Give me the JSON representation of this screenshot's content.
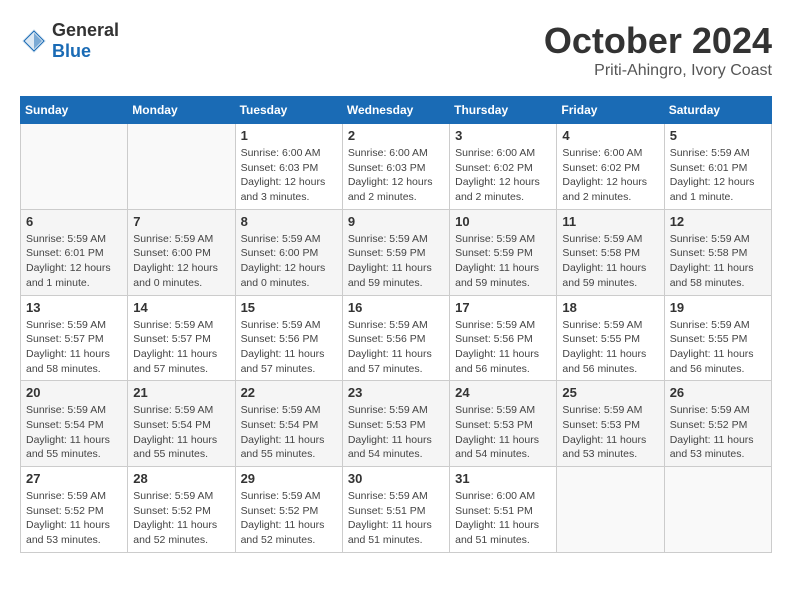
{
  "header": {
    "logo_general": "General",
    "logo_blue": "Blue",
    "month_title": "October 2024",
    "location": "Priti-Ahingro, Ivory Coast"
  },
  "weekdays": [
    "Sunday",
    "Monday",
    "Tuesday",
    "Wednesday",
    "Thursday",
    "Friday",
    "Saturday"
  ],
  "weeks": [
    [
      {
        "day": "",
        "info": ""
      },
      {
        "day": "",
        "info": ""
      },
      {
        "day": "1",
        "info": "Sunrise: 6:00 AM\nSunset: 6:03 PM\nDaylight: 12 hours and 3 minutes."
      },
      {
        "day": "2",
        "info": "Sunrise: 6:00 AM\nSunset: 6:03 PM\nDaylight: 12 hours and 2 minutes."
      },
      {
        "day": "3",
        "info": "Sunrise: 6:00 AM\nSunset: 6:02 PM\nDaylight: 12 hours and 2 minutes."
      },
      {
        "day": "4",
        "info": "Sunrise: 6:00 AM\nSunset: 6:02 PM\nDaylight: 12 hours and 2 minutes."
      },
      {
        "day": "5",
        "info": "Sunrise: 5:59 AM\nSunset: 6:01 PM\nDaylight: 12 hours and 1 minute."
      }
    ],
    [
      {
        "day": "6",
        "info": "Sunrise: 5:59 AM\nSunset: 6:01 PM\nDaylight: 12 hours and 1 minute."
      },
      {
        "day": "7",
        "info": "Sunrise: 5:59 AM\nSunset: 6:00 PM\nDaylight: 12 hours and 0 minutes."
      },
      {
        "day": "8",
        "info": "Sunrise: 5:59 AM\nSunset: 6:00 PM\nDaylight: 12 hours and 0 minutes."
      },
      {
        "day": "9",
        "info": "Sunrise: 5:59 AM\nSunset: 5:59 PM\nDaylight: 11 hours and 59 minutes."
      },
      {
        "day": "10",
        "info": "Sunrise: 5:59 AM\nSunset: 5:59 PM\nDaylight: 11 hours and 59 minutes."
      },
      {
        "day": "11",
        "info": "Sunrise: 5:59 AM\nSunset: 5:58 PM\nDaylight: 11 hours and 59 minutes."
      },
      {
        "day": "12",
        "info": "Sunrise: 5:59 AM\nSunset: 5:58 PM\nDaylight: 11 hours and 58 minutes."
      }
    ],
    [
      {
        "day": "13",
        "info": "Sunrise: 5:59 AM\nSunset: 5:57 PM\nDaylight: 11 hours and 58 minutes."
      },
      {
        "day": "14",
        "info": "Sunrise: 5:59 AM\nSunset: 5:57 PM\nDaylight: 11 hours and 57 minutes."
      },
      {
        "day": "15",
        "info": "Sunrise: 5:59 AM\nSunset: 5:56 PM\nDaylight: 11 hours and 57 minutes."
      },
      {
        "day": "16",
        "info": "Sunrise: 5:59 AM\nSunset: 5:56 PM\nDaylight: 11 hours and 57 minutes."
      },
      {
        "day": "17",
        "info": "Sunrise: 5:59 AM\nSunset: 5:56 PM\nDaylight: 11 hours and 56 minutes."
      },
      {
        "day": "18",
        "info": "Sunrise: 5:59 AM\nSunset: 5:55 PM\nDaylight: 11 hours and 56 minutes."
      },
      {
        "day": "19",
        "info": "Sunrise: 5:59 AM\nSunset: 5:55 PM\nDaylight: 11 hours and 56 minutes."
      }
    ],
    [
      {
        "day": "20",
        "info": "Sunrise: 5:59 AM\nSunset: 5:54 PM\nDaylight: 11 hours and 55 minutes."
      },
      {
        "day": "21",
        "info": "Sunrise: 5:59 AM\nSunset: 5:54 PM\nDaylight: 11 hours and 55 minutes."
      },
      {
        "day": "22",
        "info": "Sunrise: 5:59 AM\nSunset: 5:54 PM\nDaylight: 11 hours and 55 minutes."
      },
      {
        "day": "23",
        "info": "Sunrise: 5:59 AM\nSunset: 5:53 PM\nDaylight: 11 hours and 54 minutes."
      },
      {
        "day": "24",
        "info": "Sunrise: 5:59 AM\nSunset: 5:53 PM\nDaylight: 11 hours and 54 minutes."
      },
      {
        "day": "25",
        "info": "Sunrise: 5:59 AM\nSunset: 5:53 PM\nDaylight: 11 hours and 53 minutes."
      },
      {
        "day": "26",
        "info": "Sunrise: 5:59 AM\nSunset: 5:52 PM\nDaylight: 11 hours and 53 minutes."
      }
    ],
    [
      {
        "day": "27",
        "info": "Sunrise: 5:59 AM\nSunset: 5:52 PM\nDaylight: 11 hours and 53 minutes."
      },
      {
        "day": "28",
        "info": "Sunrise: 5:59 AM\nSunset: 5:52 PM\nDaylight: 11 hours and 52 minutes."
      },
      {
        "day": "29",
        "info": "Sunrise: 5:59 AM\nSunset: 5:52 PM\nDaylight: 11 hours and 52 minutes."
      },
      {
        "day": "30",
        "info": "Sunrise: 5:59 AM\nSunset: 5:51 PM\nDaylight: 11 hours and 51 minutes."
      },
      {
        "day": "31",
        "info": "Sunrise: 6:00 AM\nSunset: 5:51 PM\nDaylight: 11 hours and 51 minutes."
      },
      {
        "day": "",
        "info": ""
      },
      {
        "day": "",
        "info": ""
      }
    ]
  ]
}
